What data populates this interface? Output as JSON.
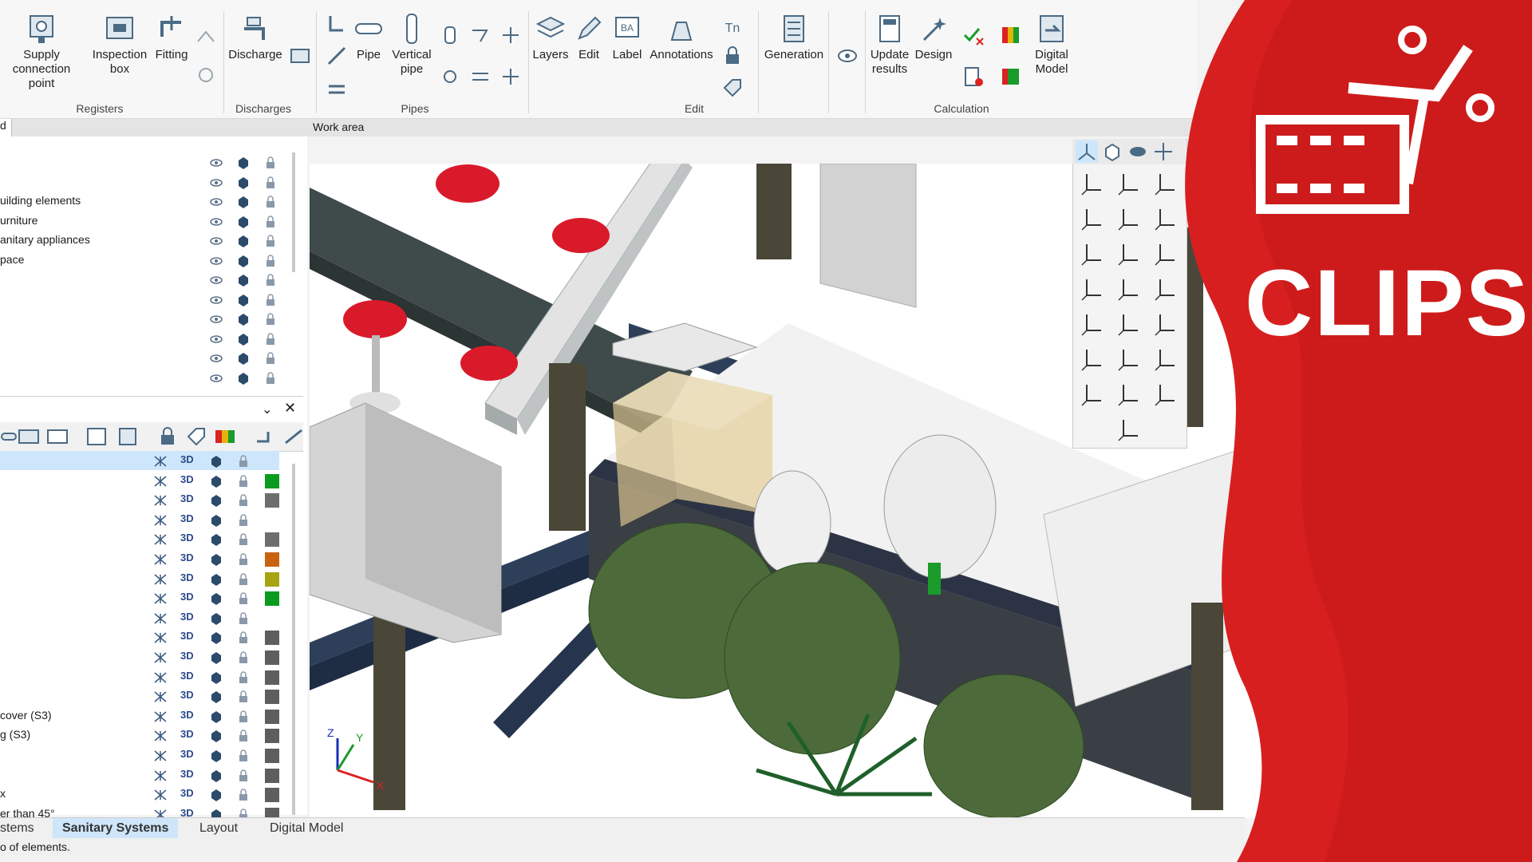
{
  "ribbon": {
    "buttons": {
      "supply": "Supply\nconnection point",
      "inspection": "Inspection\nbox",
      "fitting": "Fitting",
      "discharge": "Discharge",
      "pipe": "Pipe",
      "vertical_pipe": "Vertical\npipe",
      "layers": "Layers",
      "edit": "Edit",
      "label": "Label",
      "annotations": "Annotations",
      "generation": "Generation",
      "update_results": "Update\nresults",
      "design": "Design",
      "digital_model": "Digital\nModel"
    },
    "groups": {
      "registers": "Registers",
      "discharges": "Discharges",
      "pipes": "Pipes",
      "edit": "Edit",
      "calculation": "Calculation"
    }
  },
  "tabbar": {
    "left_tab": "d",
    "work_area": "Work area"
  },
  "layers": [
    "",
    "",
    "uilding elements",
    "urniture",
    "anitary appliances",
    "pace",
    "",
    "",
    "",
    "",
    "",
    ""
  ],
  "objects": [
    {
      "label": "",
      "swatch": ""
    },
    {
      "label": "",
      "swatch": "#0a9a1e"
    },
    {
      "label": "",
      "swatch": "#6e6e6e"
    },
    {
      "label": "",
      "swatch": ""
    },
    {
      "label": "",
      "swatch": "#6e6e6e"
    },
    {
      "label": "",
      "swatch": "#c8620f"
    },
    {
      "label": "",
      "swatch": "#a7a312"
    },
    {
      "label": "",
      "swatch": "#0a9a1e"
    },
    {
      "label": "",
      "swatch": ""
    },
    {
      "label": "",
      "swatch": "#5e5e5e"
    },
    {
      "label": "",
      "swatch": "#5e5e5e"
    },
    {
      "label": "",
      "swatch": "#5e5e5e"
    },
    {
      "label": "",
      "swatch": "#5e5e5e"
    },
    {
      "label": "cover (S3)",
      "swatch": "#5e5e5e"
    },
    {
      "label": "g (S3)",
      "swatch": "#5e5e5e"
    },
    {
      "label": "",
      "swatch": "#5e5e5e"
    },
    {
      "label": "",
      "swatch": "#5e5e5e"
    },
    {
      "label": "x",
      "swatch": "#5e5e5e"
    },
    {
      "label": "er than 45°",
      "swatch": "#5e5e5e"
    }
  ],
  "three_d_label": "3D",
  "axes": {
    "x": "X",
    "y": "Y",
    "z": "Z"
  },
  "bottom_tabs": [
    "stems",
    "Sanitary Systems",
    "Layout",
    "Digital Model"
  ],
  "status_text": "o of elements.",
  "brand": {
    "title": "CLIPS",
    "color": "#d81f1f"
  }
}
